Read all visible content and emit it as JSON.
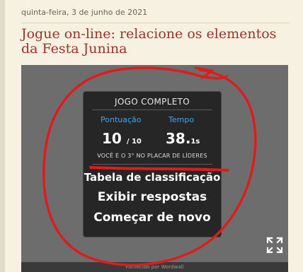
{
  "post": {
    "date": "quinta-feira, 3 de junho de 2021",
    "title": "Jogue on-line: relacione os elementos da Festa Junina"
  },
  "game": {
    "status_title": "JOGO COMPLETO",
    "score_label": "Pontuação",
    "score_value": "10",
    "score_total": "/ 10",
    "time_label": "Tempo",
    "time_value": "38.",
    "time_decimal": "1s",
    "rank_text": "VOCÊ É O 3° NO PLACAR DE LÍDERES",
    "menu": {
      "leaderboard": "Tabela de classificação",
      "show_answers": "Exibir respostas",
      "restart": "Começar de novo"
    },
    "footer": "Fornecido por Wordwall"
  },
  "colors": {
    "title": "#a0312d",
    "accent": "#3ea6f2",
    "annotation": "#e01b1b"
  },
  "icons": {
    "fullscreen": "expand-icon"
  }
}
